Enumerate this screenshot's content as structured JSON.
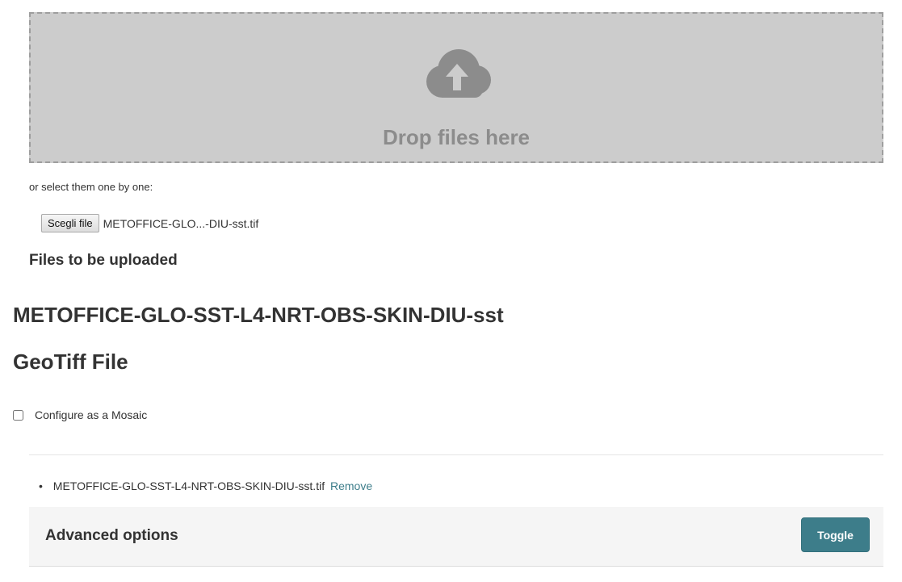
{
  "dropzone": {
    "icon": "cloud-upload-icon",
    "label": "Drop files here"
  },
  "select": {
    "text": "or select them one by one:",
    "button_label": "Scegli file",
    "file_name": "METOFFICE-GLO...-DIU-sst.tif"
  },
  "upload": {
    "section_title": "Files to be uploaded",
    "dataset_title": "METOFFICE-GLO-SST-L4-NRT-OBS-SKIN-DIU-sst",
    "file_type": "GeoTiff File",
    "mosaic_label": "Configure as a Mosaic",
    "mosaic_checked": false,
    "files": [
      {
        "name": "METOFFICE-GLO-SST-L4-NRT-OBS-SKIN-DIU-sst.tif",
        "remove_label": "Remove"
      }
    ]
  },
  "advanced": {
    "title": "Advanced options",
    "toggle_label": "Toggle"
  },
  "colors": {
    "accent": "#3d7d8a",
    "dropzone_bg": "#cccccc",
    "dropzone_text": "#8c8c8c"
  }
}
